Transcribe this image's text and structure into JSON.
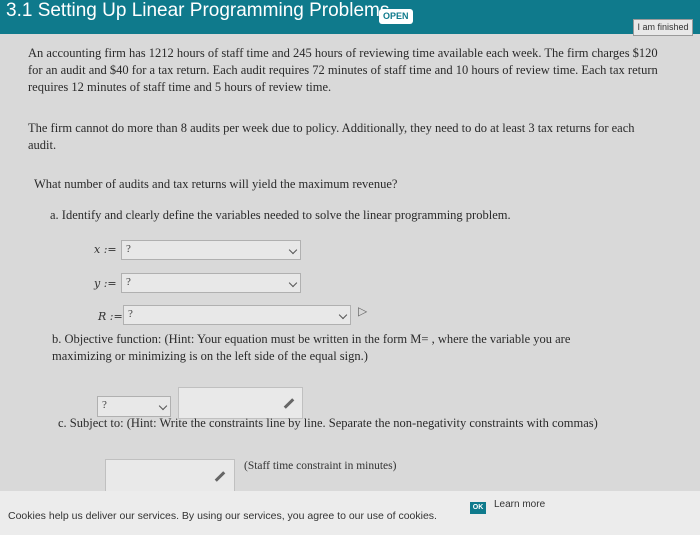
{
  "header": {
    "title": "3.1 Setting Up Linear Programming Problems",
    "badge": "OPEN",
    "finished_button": "I am finished"
  },
  "problem": {
    "paragraph1": "An accounting firm has 1212 hours of staff time and 245 hours of reviewing time available each week. The firm charges $120 for an audit and $40 for a tax return. Each audit requires 72 minutes of staff time and 10 hours of review time. Each tax return requires 12 minutes of staff time and 5 hours of review time.",
    "paragraph2": "The firm cannot do more than 8 audits per week due to policy. Additionally, they need to do at least 3 tax returns for each audit.",
    "question": "What number of audits and tax returns will yield the maximum revenue?"
  },
  "part_a": {
    "prompt": "a. Identify and clearly define the variables needed to solve the linear programming problem.",
    "x_label": "x :=",
    "x_value": "?",
    "y_label": "y :=",
    "y_value": "?",
    "r_label": "R :=",
    "r_value": "?"
  },
  "part_b": {
    "prompt": "b. Objective function: (Hint: Your equation must be written in the form M= , where the variable you are maximizing or minimizing is on the left side of the equal sign.)",
    "select_value": "?"
  },
  "part_c": {
    "prompt": "c. Subject to: (Hint: Write the constraints line by line. Separate the non-negativity constraints with commas)",
    "constraint1_label": "(Staff time constraint in minutes)"
  },
  "cookie_bar": {
    "text": "Cookies help us deliver our services. By using our services, you agree to our use of cookies.",
    "ok_label": "OK",
    "learn_more": "Learn more"
  }
}
